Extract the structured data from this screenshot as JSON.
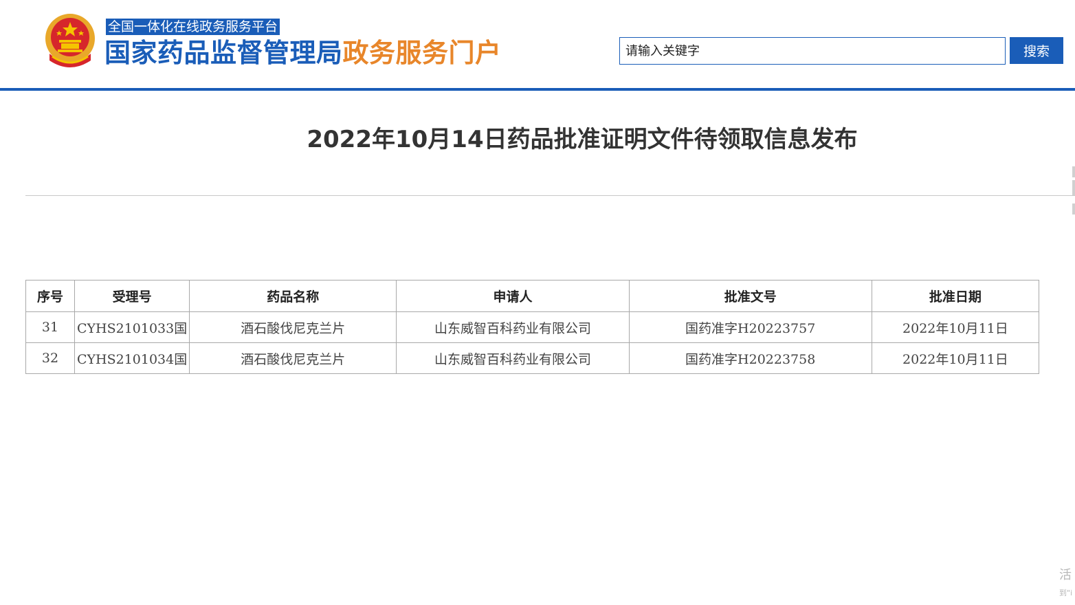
{
  "header": {
    "platform_tag": "全国一体化在线政务服务平台",
    "agency_name": "国家药品监督管理局",
    "portal_name": "政务服务门户",
    "search_placeholder": "请输入关键字",
    "search_button": "搜索",
    "brand_blue": "#1a5db8",
    "brand_orange": "#e8862a"
  },
  "article": {
    "title": "2022年10月14日药品批准证明文件待领取信息发布"
  },
  "table": {
    "columns": [
      "序号",
      "受理号",
      "药品名称",
      "申请人",
      "批准文号",
      "批准日期"
    ],
    "rows": [
      [
        "31",
        "CYHS2101033国",
        "酒石酸伐尼克兰片",
        "山东威智百科药业有限公司",
        "国药准字H20223757",
        "2022年10月11日"
      ],
      [
        "32",
        "CYHS2101034国",
        "酒石酸伐尼克兰片",
        "山东威智百科药业有限公司",
        "国药准字H20223758",
        "2022年10月11日"
      ]
    ]
  },
  "corner": {
    "line1": "活",
    "line2": "到\"i"
  }
}
